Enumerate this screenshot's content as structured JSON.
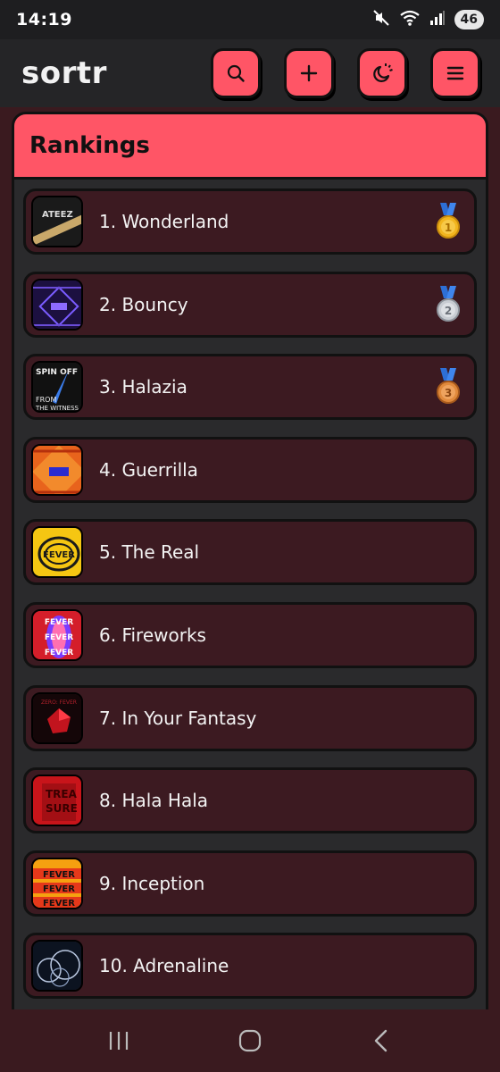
{
  "status": {
    "time": "14:19",
    "battery": "46"
  },
  "header": {
    "logo": "sortr"
  },
  "panel": {
    "title": "Rankings"
  },
  "rankings": [
    {
      "label": "1.  Wonderland",
      "medal": "gold",
      "medal_num": "1"
    },
    {
      "label": "2.  Bouncy",
      "medal": "silver",
      "medal_num": "2"
    },
    {
      "label": "3.  Halazia",
      "medal": "bronze",
      "medal_num": "3"
    },
    {
      "label": "4.  Guerrilla"
    },
    {
      "label": "5.  The Real"
    },
    {
      "label": "6.  Fireworks"
    },
    {
      "label": "7.  In Your Fantasy"
    },
    {
      "label": "8.  Hala Hala"
    },
    {
      "label": "9.  Inception"
    },
    {
      "label": "10.  Adrenaline"
    }
  ],
  "colors": {
    "accent": "#ff5566",
    "item_bg": "#3c1a21",
    "panel_bg": "#2a2a2c"
  }
}
